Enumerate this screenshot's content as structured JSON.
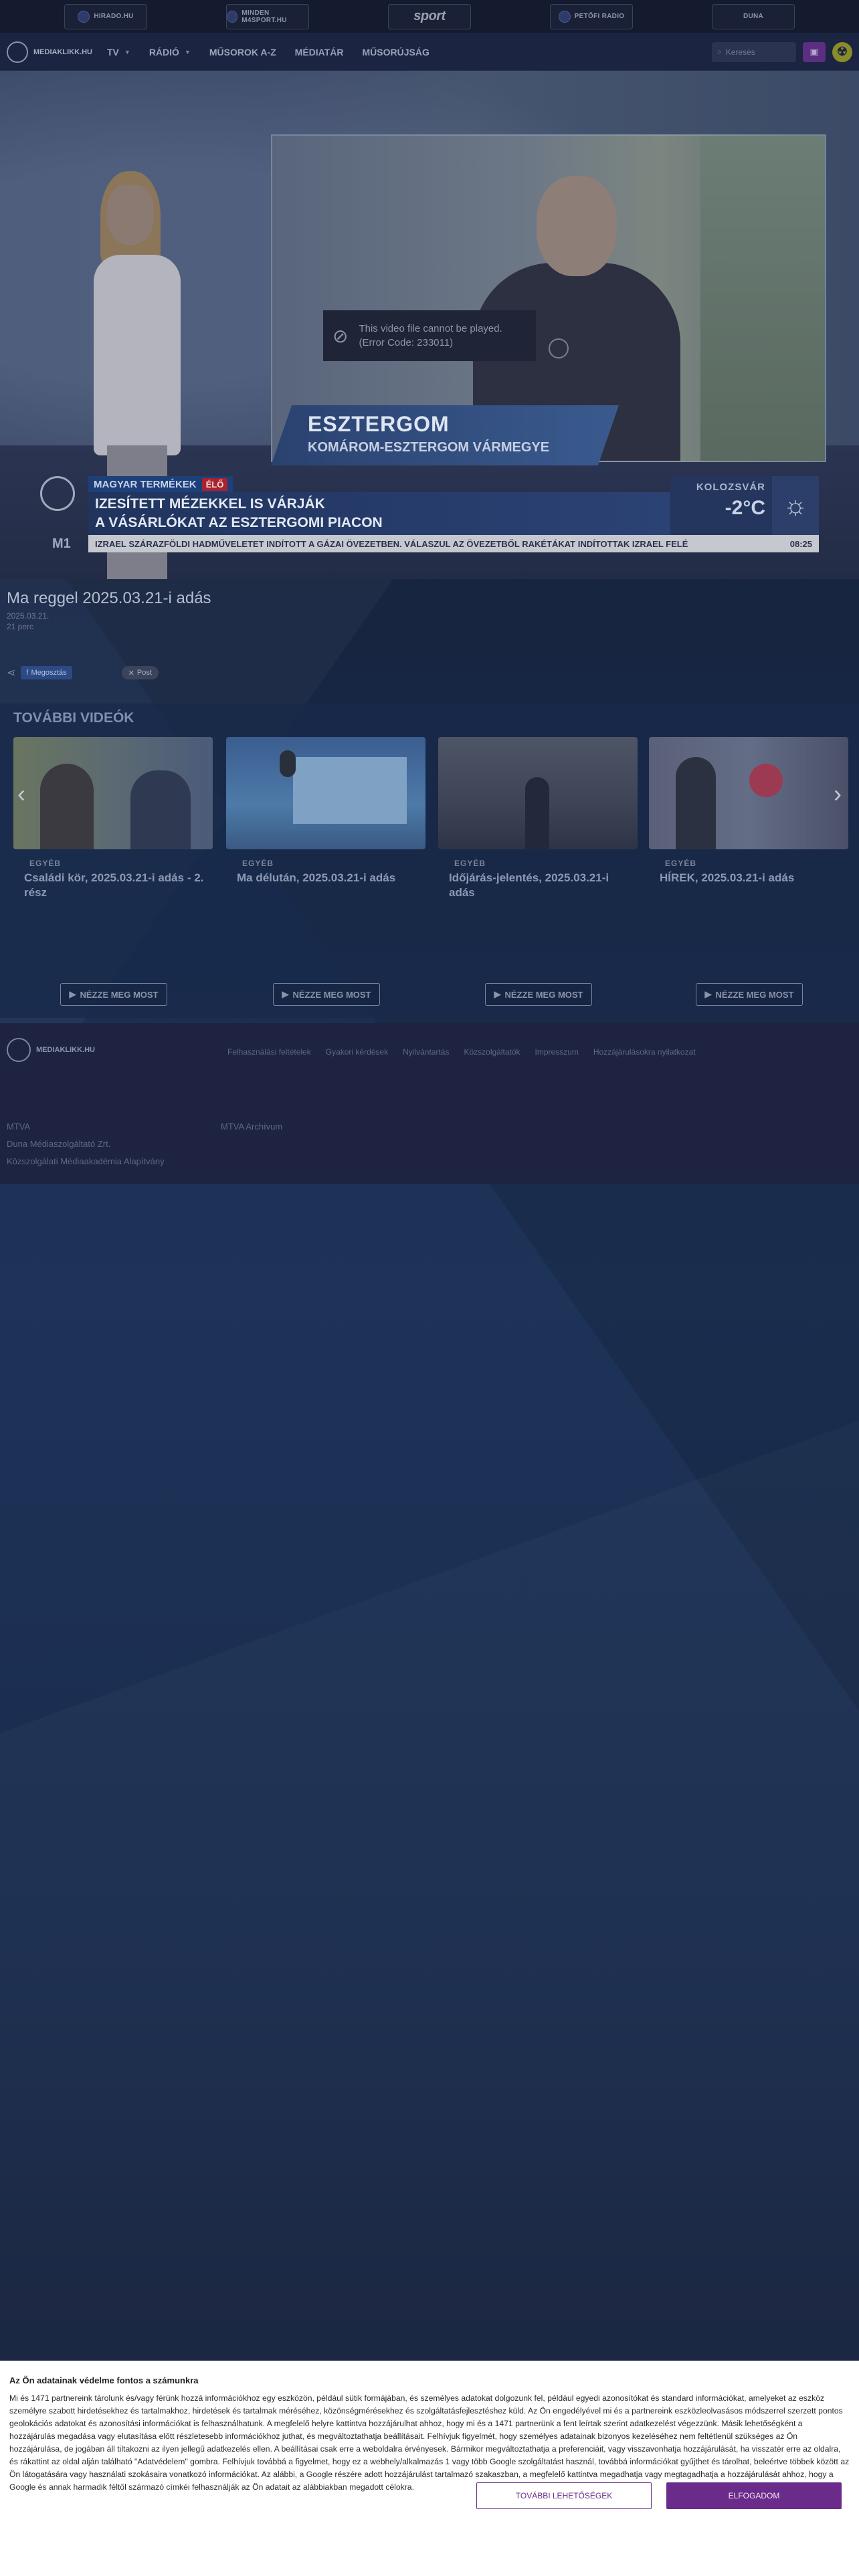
{
  "partners": [
    {
      "label": "HIRADO.HU",
      "icon": "hirado-logo-icon"
    },
    {
      "label": "MINDEN M4SPORT.HU",
      "icon": "m4sport-logo-icon"
    },
    {
      "label": "sport",
      "icon": "m4-sport-wordmark"
    },
    {
      "label": "PETŐFI RADIO",
      "icon": "petofi-radio-icon"
    },
    {
      "label": "DUNA",
      "icon": "duna-logo-icon"
    }
  ],
  "nav": {
    "logo": "MEDIAKLIKK.HU",
    "items": [
      "TV",
      "RÁDIÓ",
      "MŰSOROK A-Z",
      "MÉDIATÁR",
      "MŰSORÚJSÁG"
    ],
    "search_placeholder": "Keresés"
  },
  "video": {
    "error_line1": "This video file cannot be played.",
    "error_line2": "(Error Code: 233011)",
    "location_city": "ESZTERGOM",
    "location_county": "KOMÁROM-ESZTERGOM VÁRMEGYE",
    "channel": "M1",
    "show_tag": "MAGYAR TERMÉKEK",
    "live_tag": "ÉLŐ",
    "headline_line1": "IZESÍTETT MÉZEKKEL IS VÁRJÁK",
    "headline_line2": "A VÁSÁRLÓKAT AZ ESZTERGOMI PIACON",
    "weather_city": "KOLOZSVÁR",
    "weather_temp": "-2°C",
    "ticker": "IZRAEL SZÁRAZFÖLDI HADMŰVELETET INDÍTOTT A GÁZAI ÖVEZETBEN. VÁLASZUL AZ ÖVEZETBŐL RAKÉTÁKAT INDÍTOTTAK IZRAEL FELÉ",
    "ticker_time": "08:25"
  },
  "info": {
    "title": "Ma reggel 2025.03.21-i adás",
    "date": "2025.03.21.",
    "duration": "21 perc",
    "share_fb": "Megosztás",
    "share_x": "Post"
  },
  "more_videos": {
    "title": "TOVÁBBI VIDEÓK",
    "watch_label": "NÉZZE MEG MOST",
    "cards": [
      {
        "category": "EGYÉB",
        "title": "Családi kör, 2025.03.21-i adás - 2. rész"
      },
      {
        "category": "EGYÉB",
        "title": "Ma délután, 2025.03.21-i adás"
      },
      {
        "category": "EGYÉB",
        "title": "Időjárás-jelentés, 2025.03.21-i adás"
      },
      {
        "category": "EGYÉB",
        "title": "HÍREK, 2025.03.21-i adás"
      }
    ]
  },
  "footer": {
    "logo": "MEDIAKLIKK.HU",
    "links": [
      "Felhasználási feltételek",
      "Gyakori kérdések",
      "Nyilvántartás",
      "Közszolgáltatók",
      "Impresszum",
      "Hozzájárulásokra nyilatkozat"
    ],
    "col1": [
      "MTVA",
      "Duna Médiaszolgáltató Zrt.",
      "Közszolgálati Médiaakadémia Alapítvány"
    ],
    "col2": [
      "MTVA Archívum"
    ]
  },
  "consent": {
    "title": "Az Ön adatainak védelme fontos a számunkra",
    "body": "Mi és 1471 partnereink tárolunk és/vagy férünk hozzá információkhoz egy eszközön, például sütik formájában, és személyes adatokat dolgozunk fel, például egyedi azonosítókat és standard információkat, amelyeket az eszköz személyre szabott hirdetésekhez és tartalmakhoz, hirdetések és tartalmak méréséhez, közönségmérésekhez és szolgáltatásfejlesztéshez küld. Az Ön engedélyével mi és a partnereink eszközleolvasásos módszerrel szerzett pontos geolokációs adatokat és azonosítási információkat is felhasználhatunk. A megfelelő helyre kattintva hozzájárulhat ahhoz, hogy mi és a 1471 partnerünk a fent leírtak szerint adatkezelést végezzünk. Másik lehetőségként a hozzájárulás megadása vagy elutasítása előtt részletesebb információkhoz juthat, és megváltoztathatja beállításait. Felhívjuk figyelmét, hogy személyes adatainak bizonyos kezeléséhez nem feltétlenül szükséges az Ön hozzájárulása, de jogában áll tiltakozni az ilyen jellegű adatkezelés ellen. A beállításai csak erre a weboldalra érvényesek. Bármikor megváltoztathatja a preferenciáit, vagy visszavonhatja hozzájárulását, ha visszatér erre az oldalra, és rákattint az oldal alján található \"Adatvédelem\" gombra. Felhívjuk továbbá a figyelmet, hogy ez a webhely/alkalmazás 1 vagy több Google szolgáltatást használ, továbbá információkat gyűjthet és tárolhat, beleértve többek között az Ön látogatására vagy használati szokásaira vonatkozó információkat. Az alábbi, a Google részére adott hozzájárulást tartalmazó szakaszban, a megfelelő kattintva megadhatja vagy megtagadhatja a hozzájárulását ahhoz, hogy a Google és annak harmadik féltől származó címkéi felhasználják az Ön adatait az alábbiakban megadott célokra.",
    "more_options": "TOVÁBBI LEHETŐSÉGEK",
    "accept": "ELFOGADOM"
  },
  "colors": {
    "accent": "#6b2b8a",
    "live_red": "#a8232d",
    "page_bg": "#1b2744"
  }
}
